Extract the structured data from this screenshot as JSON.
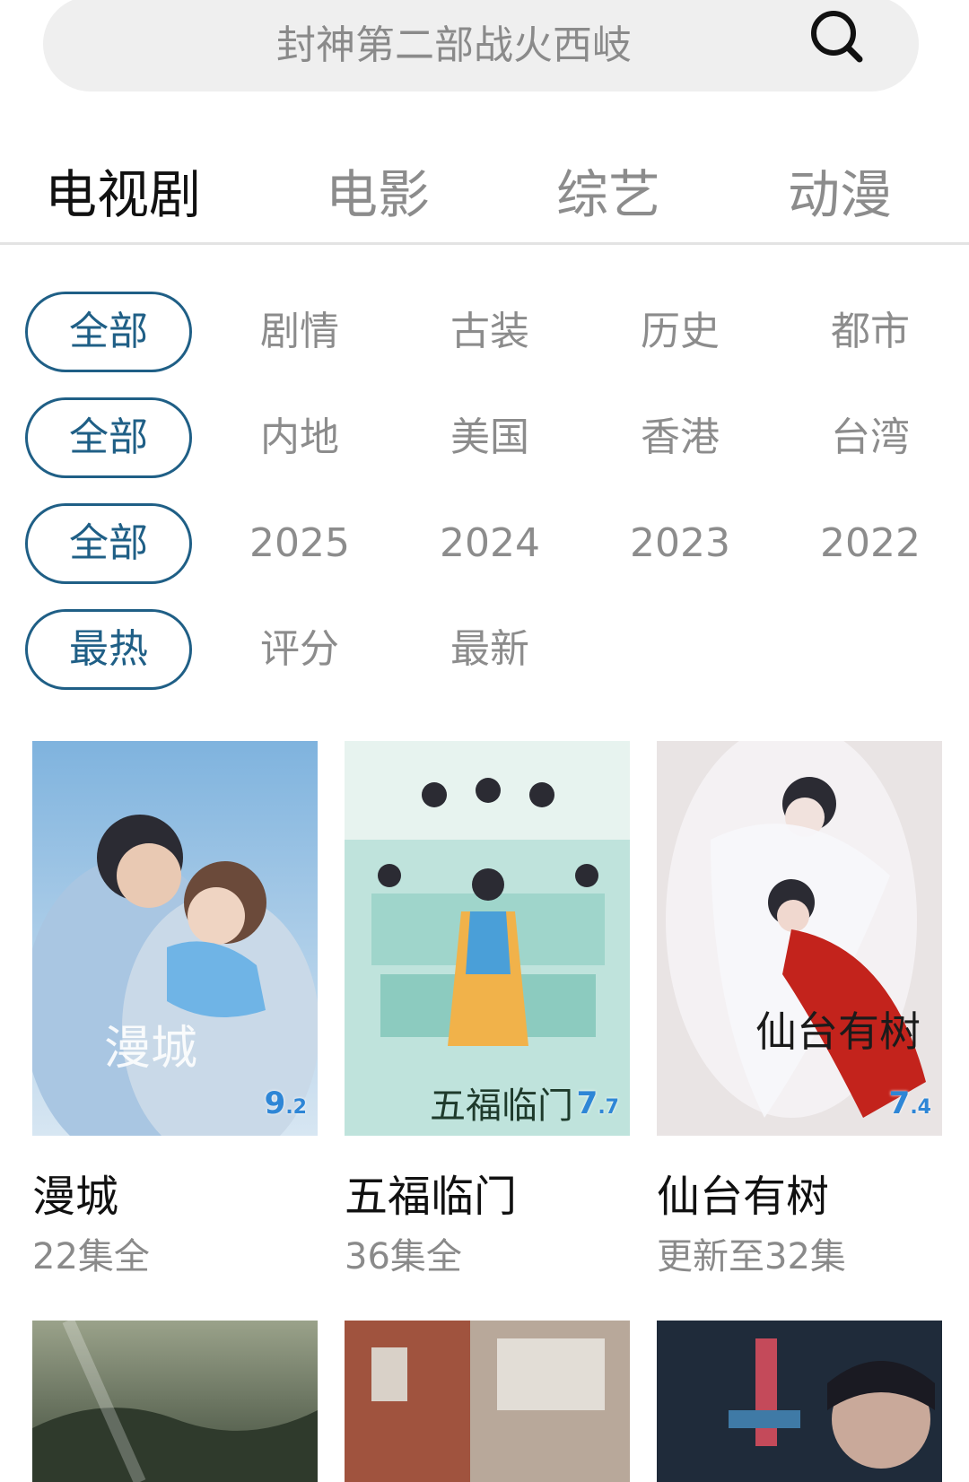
{
  "search": {
    "placeholder": "封神第二部战火西岐",
    "icon": "search-icon"
  },
  "tabs": [
    {
      "label": "电视剧",
      "active": true
    },
    {
      "label": "电影",
      "active": false
    },
    {
      "label": "综艺",
      "active": false
    },
    {
      "label": "动漫",
      "active": false
    }
  ],
  "filters": {
    "genre": {
      "selected": "全部",
      "options": [
        "剧情",
        "古装",
        "历史",
        "都市"
      ]
    },
    "region": {
      "selected": "全部",
      "options": [
        "内地",
        "美国",
        "香港",
        "台湾"
      ]
    },
    "year": {
      "selected": "全部",
      "options": [
        "2025",
        "2024",
        "2023",
        "2022"
      ]
    },
    "sort": {
      "selected": "最热",
      "options": [
        "评分",
        "最新"
      ]
    }
  },
  "cards": [
    {
      "title": "漫城",
      "status": "22集全",
      "rating_main": "9",
      "rating_dec": ".2",
      "poster_text": "漫城"
    },
    {
      "title": "五福临门",
      "status": "36集全",
      "rating_main": "7",
      "rating_dec": ".7",
      "poster_text": "五福临门"
    },
    {
      "title": "仙台有树",
      "status": "更新至32集",
      "rating_main": "7",
      "rating_dec": ".4",
      "poster_text": "仙台有树"
    }
  ],
  "colors": {
    "accent": "#1f5f86",
    "muted": "#8c8c8c",
    "search_bg": "#efefef"
  }
}
